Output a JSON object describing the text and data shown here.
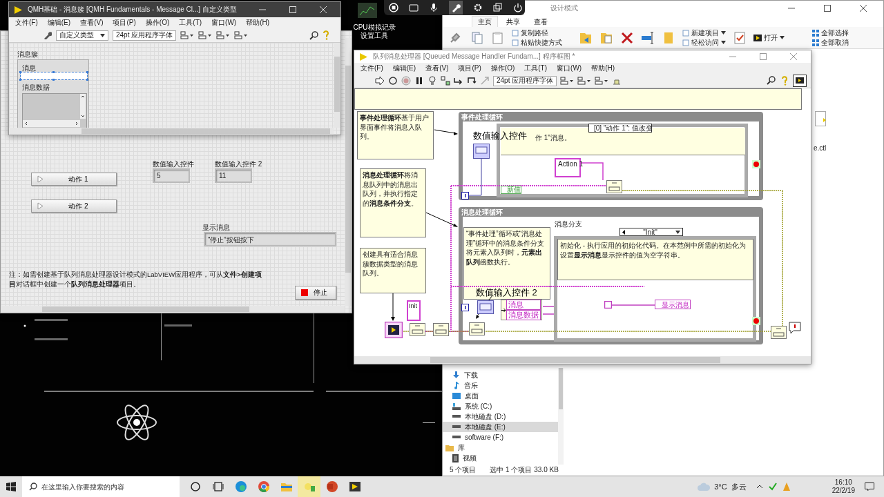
{
  "desktop": {
    "icon_label": "CPU模拟记录设置工具"
  },
  "explorer": {
    "title": "设计模式",
    "tabs": [
      {
        "label": "主页",
        "selected": true
      },
      {
        "label": "共享",
        "selected": false
      },
      {
        "label": "查看",
        "selected": false
      }
    ],
    "ribbon_groups": [
      [
        {
          "label": "复制路径",
          "dropdown": false
        },
        {
          "label": "粘贴快捷方式",
          "dropdown": false
        }
      ],
      [
        {
          "label": "新建项目",
          "dropdown": true
        },
        {
          "label": "轻松访问",
          "dropdown": true
        }
      ],
      [
        {
          "label": "打开",
          "dropdown": true
        }
      ],
      [
        {
          "label": "全部选择",
          "dropdown": false
        },
        {
          "label": "全部取消",
          "dropdown": false
        }
      ]
    ],
    "file_label": "e.ctl",
    "nav_items": [
      {
        "label": "下载",
        "kind": "download",
        "selected": false
      },
      {
        "label": "音乐",
        "kind": "music",
        "selected": false
      },
      {
        "label": "桌面",
        "kind": "desktop",
        "selected": false
      },
      {
        "label": "系统 (C:)",
        "kind": "system",
        "selected": false
      },
      {
        "label": "本地磁盘 (D:)",
        "kind": "drive",
        "selected": false
      },
      {
        "label": "本地磁盘 (E:)",
        "kind": "drive",
        "selected": true
      },
      {
        "label": "software (F:)",
        "kind": "drive",
        "selected": false
      },
      {
        "label": "库",
        "kind": "library",
        "selected": false
      },
      {
        "label": "视频",
        "kind": "video",
        "selected": false
      }
    ],
    "status": [
      "5 个项目",
      "选中 1 个项目  33.0 KB"
    ]
  },
  "type_window": {
    "title": "QMH基础 - 消息簇 [QMH Fundamentals - Message Cl...] 自定义类型",
    "menu": [
      "文件(F)",
      "编辑(E)",
      "查看(V)",
      "项目(P)",
      "操作(O)",
      "工具(T)",
      "窗口(W)",
      "帮助(H)"
    ],
    "type_dropdown": "自定义类型",
    "font_dropdown": "24pt 应用程序字体",
    "cluster": {
      "label": "消息簇",
      "fields": [
        {
          "label": "消息",
          "kind": "string",
          "selected": true
        },
        {
          "label": "消息数据",
          "kind": "array",
          "selected": false
        }
      ]
    }
  },
  "front_panel": {
    "buttons": [
      {
        "label": "动作 1"
      },
      {
        "label": "动作 2"
      }
    ],
    "numerics": [
      {
        "label": "数值输入控件",
        "value": "5"
      },
      {
        "label": "数值输入控件 2",
        "value": "11"
      }
    ],
    "indicator": {
      "label": "显示消息",
      "value": "“停止”按钮按下"
    },
    "note": "注：如需创建基于队列消息处理器设计模式的LabVIEW应用程序，可从**文件>创建项目**对话框中创建一个**队列消息处理器**项目。",
    "stop_button": "停止"
  },
  "diagram_window": {
    "title": "队列消息处理器 [Queued Message Handler Fundam...] 程序框图 *",
    "menu": [
      "文件(F)",
      "编辑(E)",
      "查看(V)",
      "项目(P)",
      "操作(O)",
      "工具(T)",
      "窗口(W)",
      "帮助(H)"
    ],
    "font_dropdown": "24pt 应用程序字体",
    "comments": [
      "**事件处理循环**基于用户界面事件将消息入队列。",
      "**消息处理循环**将消息队列中的消息出队列，并执行指定的**消息条件分支**。",
      "创建具有适合消息簇数据类型的消息队列。"
    ],
    "event_loop": {
      "label": "事件处理循环",
      "selector": "[0] \"动作 1\": 值改变",
      "comment": "作 1\"消息。",
      "control_label": "数值输入控件",
      "constant": "Action 1",
      "new_value": "新值"
    },
    "message_loop": {
      "label": "消息处理循环",
      "comment": "“事件处理”循环或“消息处理”循环中的消息条件分支将元素入队列时，**元素出队列**函数执行。",
      "case_label": "消息分支",
      "selector": "\"Init\"",
      "case_comment": "初始化 - 执行应用的初始化代码。在本范例中所需的初始化为设置**显示消息**显示控件的值为空字符串。",
      "control_label": "数值输入控件 2",
      "unbundle": [
        "消息",
        "消息数据"
      ],
      "local": "显示消息"
    },
    "init_constant": "Init"
  },
  "taskbar": {
    "search_placeholder": "在这里输入你要搜索的内容",
    "temperature": "3°C",
    "weather": "多云",
    "time": "16:10",
    "date": "22/2/19"
  }
}
